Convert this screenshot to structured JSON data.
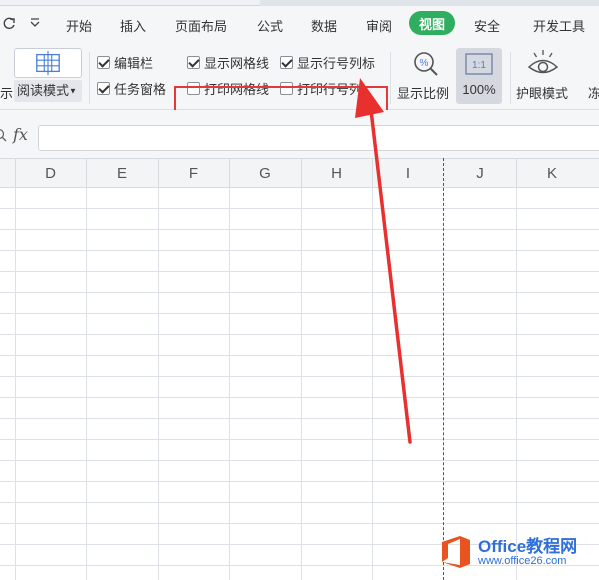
{
  "menu": {
    "items": [
      "开始",
      "插入",
      "页面布局",
      "公式",
      "数据",
      "审阅",
      "视图",
      "安全",
      "开发工具"
    ],
    "active": "视图"
  },
  "ribbon": {
    "left_cut_label": "示",
    "read_mode_label": "阅读模式",
    "checkboxes": {
      "edit_bar": {
        "label": "编辑栏",
        "checked": true
      },
      "task_pane": {
        "label": "任务窗格",
        "checked": true
      },
      "show_gridlines": {
        "label": "显示网格线",
        "checked": true
      },
      "show_headings": {
        "label": "显示行号列标",
        "checked": true
      },
      "print_gridlines": {
        "label": "打印网格线",
        "checked": false
      },
      "print_headings": {
        "label": "打印行号列",
        "checked": false
      }
    },
    "zoom_label": "显示比例",
    "zoom_100_icon_text": "1:1",
    "zoom_100_label": "100%",
    "eye_mode_label": "护眼模式",
    "right_cut_label": "冻"
  },
  "formula_bar": {
    "fx_label": "fx",
    "value": ""
  },
  "grid": {
    "columns": [
      "D",
      "E",
      "F",
      "G",
      "H",
      "I",
      "J",
      "K"
    ]
  },
  "watermark": {
    "title": "Office教程网",
    "url": "www.office26.com"
  },
  "colors": {
    "active_tab": "#2fae5f",
    "highlight_box": "#e23a3a",
    "arrow": "#e8302f",
    "watermark": "#2f6fd8",
    "watermark_logo": "#e8531f"
  }
}
